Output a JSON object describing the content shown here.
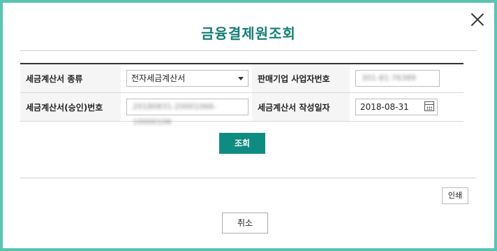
{
  "dialog": {
    "title": "금융결제원조회",
    "close_icon": "close-icon"
  },
  "form": {
    "row1": {
      "label1": "세금계산서 종류",
      "select_value": "전자세금계산서",
      "label2": "판매기업 사업자번호",
      "biz_no_value": "301-81-76389"
    },
    "row2": {
      "label1": "세금계산서(승인)번호",
      "approval_no_value": "20180831-20001066-10000106",
      "label2": "세금계산서 작성일자",
      "date_value": "2018-08-31",
      "calendar_icon": "calendar-icon"
    }
  },
  "buttons": {
    "search": "조회",
    "print": "인쇄",
    "cancel": "취소"
  },
  "colors": {
    "frame": "#5cc3b3",
    "title": "#147f76",
    "primary_button": "#0f8c82"
  }
}
